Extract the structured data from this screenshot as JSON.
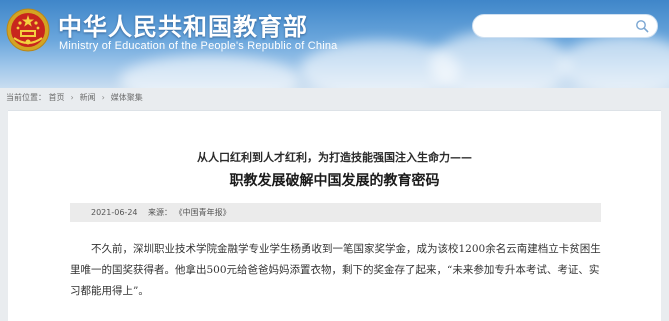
{
  "site": {
    "title": "中华人民共和国教育部",
    "subtitle": "Ministry of Education of the People's Republic of China",
    "emblem_icon": "national-emblem-icon"
  },
  "search": {
    "value": "",
    "placeholder": "",
    "icon": "search-icon"
  },
  "breadcrumb": {
    "prefix": "当前位置：",
    "items": [
      "首页",
      "新闻",
      "媒体聚集"
    ],
    "separator": "›"
  },
  "article": {
    "pretitle": "从人口红利到人才红利，为打造技能强国注入生命力——",
    "headline": "职教发展破解中国发展的教育密码",
    "date": "2021-06-24",
    "source_label": "来源：",
    "source": "《中国青年报》",
    "paragraph": "不久前，深圳职业技术学院金融学专业学生杨勇收到一笔国家奖学金，成为该校1200余名云南建档立卡贫困生里唯一的国奖获得者。他拿出500元给爸爸妈妈添置衣物，剩下的奖金存了起来，“未来参加专升本考试、考证、实习都能用得上”。"
  },
  "colors": {
    "header_top": "#3f86c9",
    "header_bottom": "#c9ddf0",
    "page_bg": "#e9ecef",
    "card_bg": "#ffffff",
    "meta_bg": "#ebebeb"
  }
}
